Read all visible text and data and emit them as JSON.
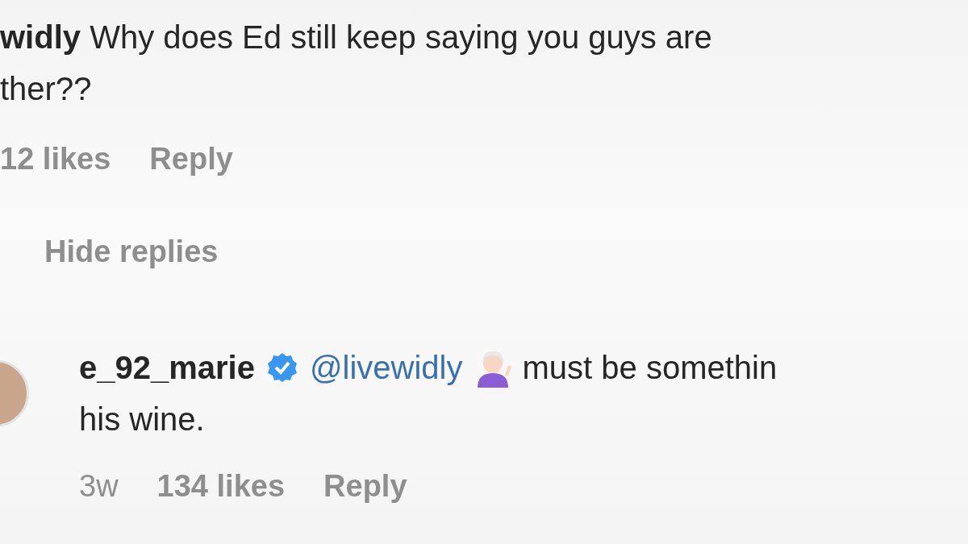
{
  "comment": {
    "username": "widly",
    "lines": [
      "Why does Ed still keep saying you guys are",
      "ther??"
    ],
    "likes": "12 likes",
    "reply": "Reply"
  },
  "hide_replies": "Hide replies",
  "replies": [
    {
      "username": "e_92_marie",
      "verified": true,
      "mention": "@livewidly",
      "text_lines": [
        "must be somethin",
        "his wine."
      ],
      "time": "3w",
      "likes": "134 likes",
      "reply": "Reply"
    }
  ]
}
